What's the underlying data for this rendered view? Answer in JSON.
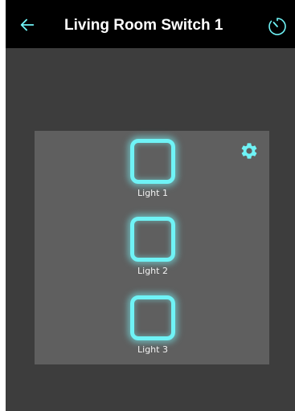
{
  "header": {
    "title": "Living Room Switch 1",
    "back_icon": "back-arrow-icon",
    "timer_icon": "timer-icon"
  },
  "panel": {
    "settings_icon": "gear-icon",
    "lights": [
      {
        "label": "Light 1"
      },
      {
        "label": "Light 2"
      },
      {
        "label": "Light 3"
      }
    ]
  },
  "colors": {
    "accent": "#6ff3f6",
    "header_bg": "#000000",
    "screen_bg": "#3d3d3d",
    "panel_bg": "#5f5f5f"
  }
}
